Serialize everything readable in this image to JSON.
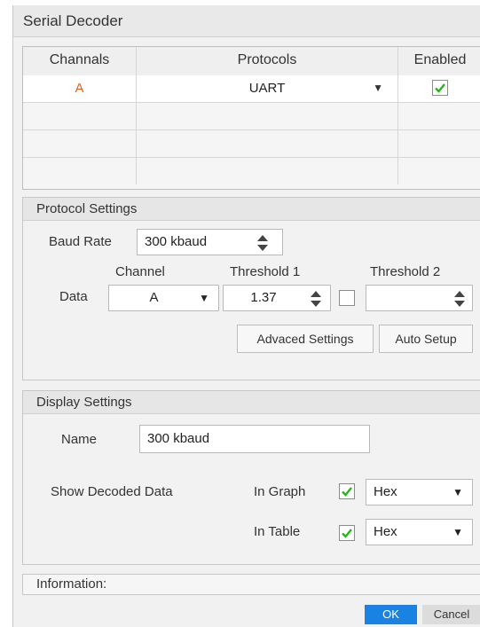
{
  "window": {
    "title": "Serial Decoder"
  },
  "channels_table": {
    "headers": {
      "channels": "Channals",
      "protocols": "Protocols",
      "enabled": "Enabled"
    },
    "rows": [
      {
        "channel": "A",
        "protocol": "UART",
        "enabled": true
      }
    ],
    "empty_rows": 3
  },
  "protocol_settings": {
    "title": "Protocol Settings",
    "baud_rate_label": "Baud Rate",
    "baud_rate_value": "300 kbaud",
    "channel_header": "Channel",
    "threshold1_header": "Threshold 1",
    "threshold2_header": "Threshold 2",
    "data_label": "Data",
    "data_channel": "A",
    "threshold1_value": "1.37",
    "threshold2_checked": false,
    "threshold2_value": "",
    "advanced_button": "Advaced Settings",
    "auto_setup_button": "Auto Setup"
  },
  "display_settings": {
    "title": "Display Settings",
    "name_label": "Name",
    "name_value": "300 kbaud",
    "show_decoded_label": "Show Decoded Data",
    "in_graph_label": "In Graph",
    "in_graph_checked": true,
    "in_graph_format": "Hex",
    "in_table_label": "In Table",
    "in_table_checked": true,
    "in_table_format": "Hex"
  },
  "information": {
    "label": "Information:"
  },
  "buttons": {
    "ok": "OK",
    "cancel": "Cancel"
  },
  "colors": {
    "accent": "#1a82e2",
    "channel_a": "#e0641e",
    "check": "#22b814"
  }
}
